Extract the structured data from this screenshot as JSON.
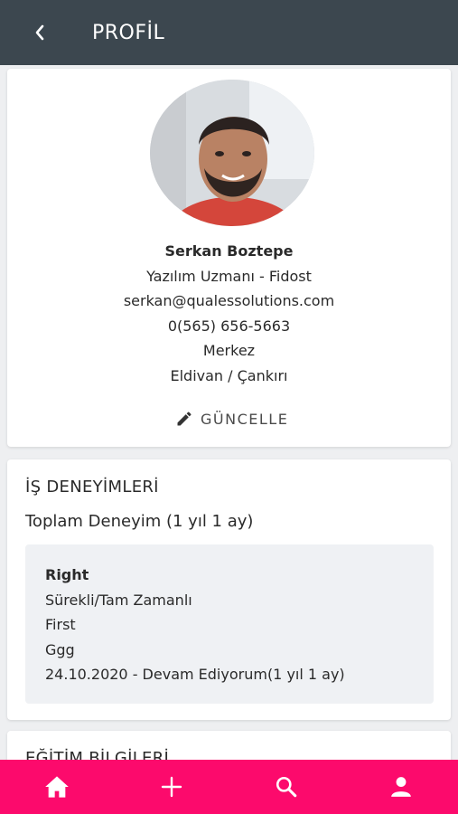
{
  "app_bar": {
    "title": "PROFİL"
  },
  "profile": {
    "name": "Serkan Boztepe",
    "position": "Yazılım Uzmanı - Fidost",
    "email": "serkan@qualessolutions.com",
    "phone": "0(565) 656-5663",
    "district": "Merkez",
    "location": "Eldivan / Çankırı",
    "update_label": "GÜNCELLE"
  },
  "experience": {
    "section_title": "İŞ DENEYİMLERİ",
    "total": "Toplam Deneyim (1 yıl 1 ay)",
    "jobs": [
      {
        "title": "Right",
        "type": "Sürekli/Tam Zamanlı",
        "company": "First",
        "extra": "Ggg",
        "dates": "24.10.2020 - Devam Ediyorum(1 yıl 1 ay)"
      }
    ]
  },
  "education": {
    "section_title": "EĞİTİM BİLGİLERİ"
  },
  "colors": {
    "app_bar": "#3c474f",
    "bottom_nav": "#fc0a6c",
    "background": "#eeeff1"
  },
  "bottom_nav": {
    "icons": [
      "home-icon",
      "plus-icon",
      "search-icon",
      "user-icon"
    ]
  }
}
